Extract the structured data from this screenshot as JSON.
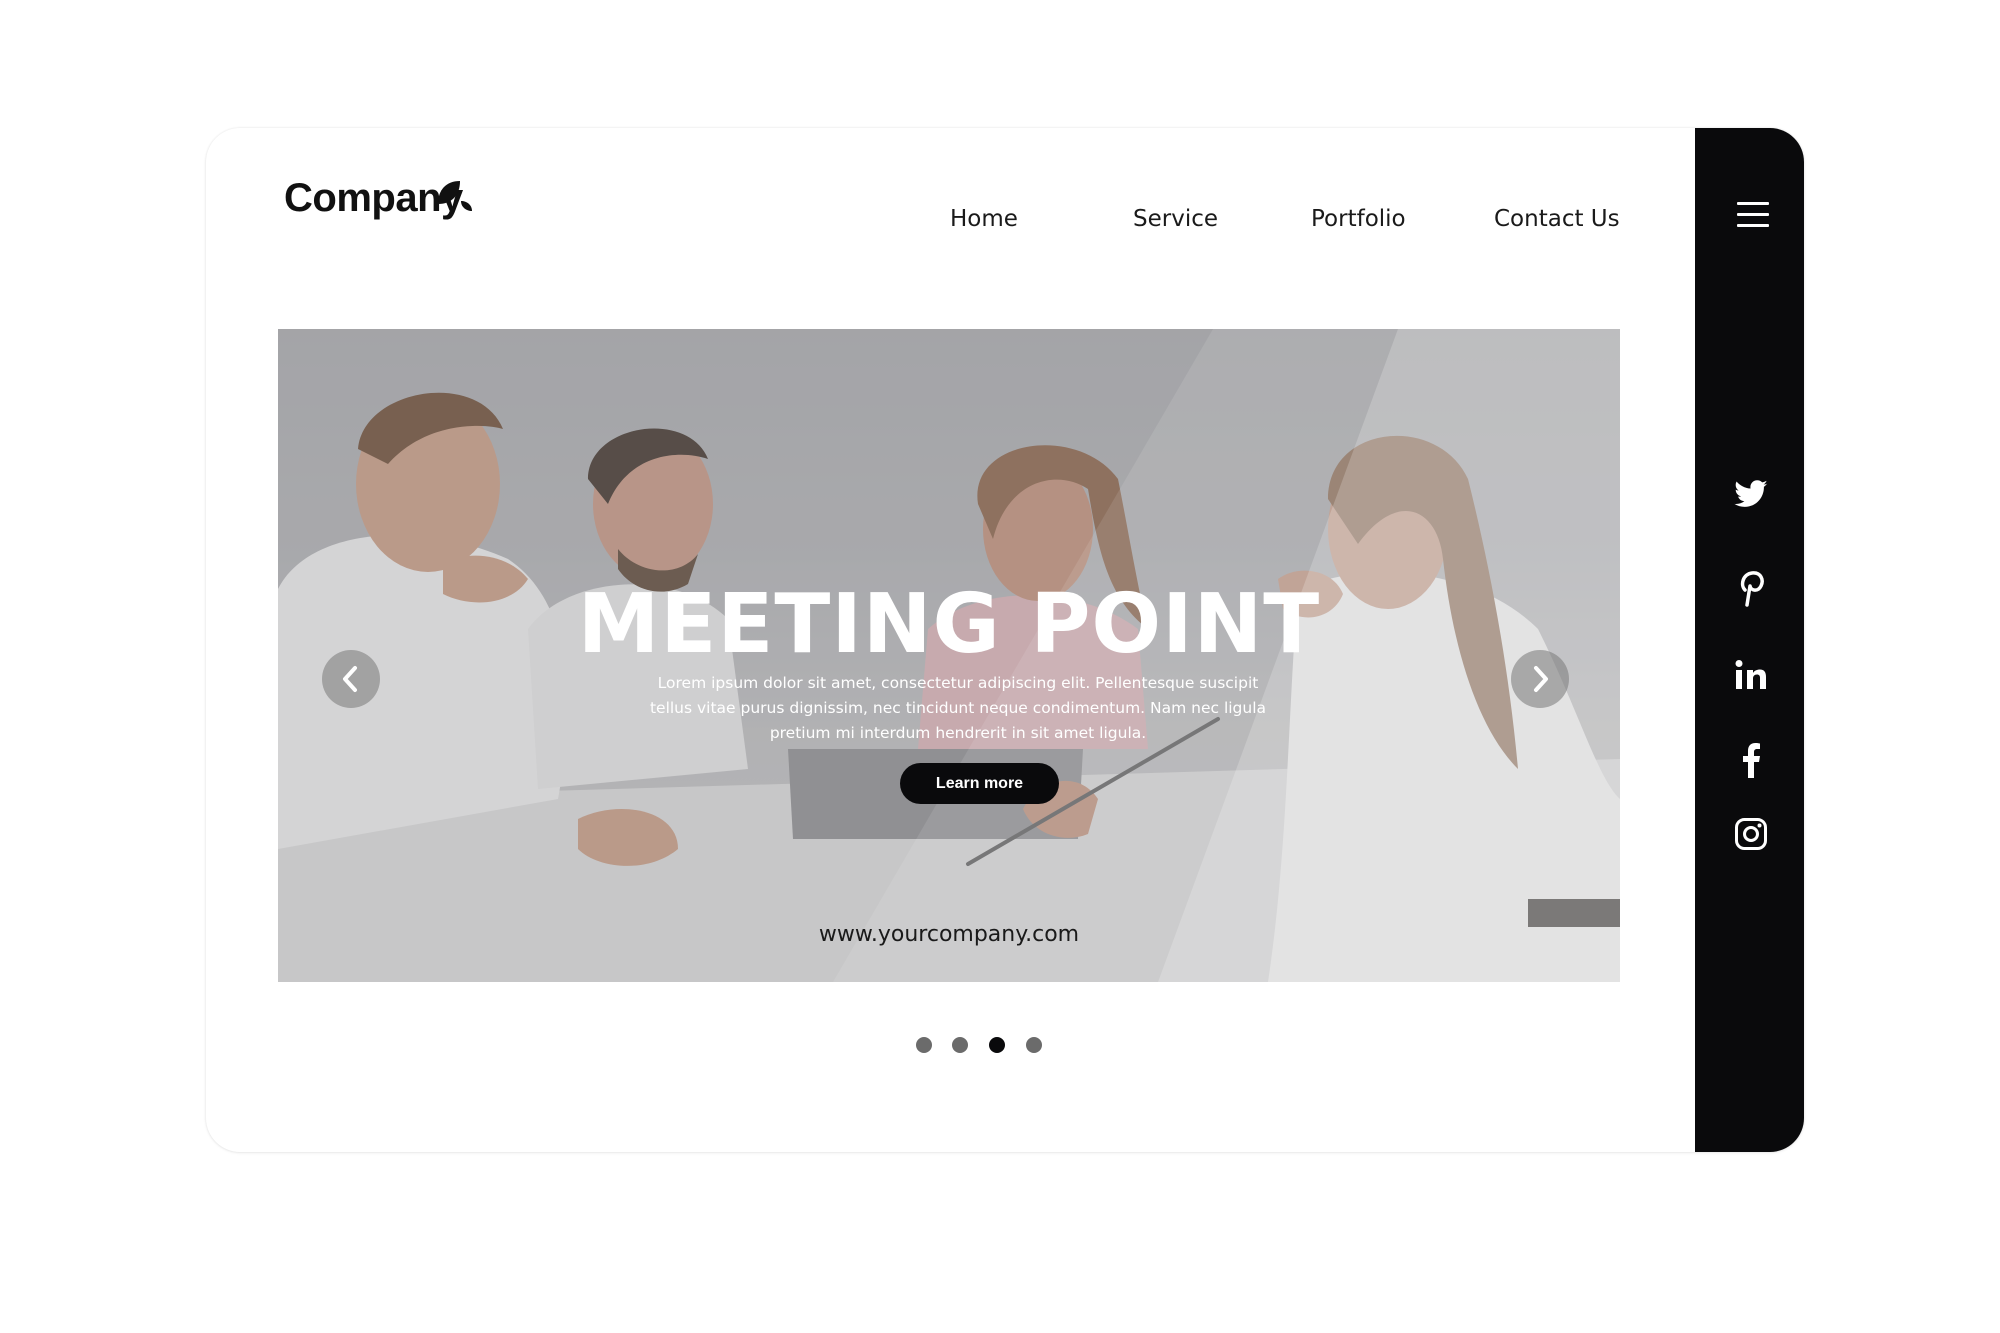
{
  "brand": {
    "name": "Company"
  },
  "nav": {
    "items": [
      {
        "label": "Home"
      },
      {
        "label": "Service"
      },
      {
        "label": "Portfolio"
      },
      {
        "label": "Contact Us"
      }
    ]
  },
  "hero": {
    "title": "MEETING POINT",
    "description": "Lorem ipsum dolor sit amet, consectetur adipiscing elit. Pellentesque suscipit tellus vitae purus dignissim, nec tincidunt neque condimentum. Nam nec ligula pretium mi interdum hendrerit in sit amet ligula.",
    "button_label": "Learn more",
    "website": "www.yourcompany.com",
    "prev_icon": "chevron-left-icon",
    "next_icon": "chevron-right-icon"
  },
  "carousel": {
    "slide_count": 4,
    "active_slide": 3
  },
  "sidebar": {
    "menu_icon": "hamburger-menu-icon",
    "social": [
      "twitter-icon",
      "pinterest-icon",
      "linkedin-icon",
      "facebook-icon",
      "instagram-icon"
    ]
  },
  "colors": {
    "accent": "#0a0a0c",
    "background": "#ffffff",
    "text": "#1a1a1a",
    "dot_inactive": "#6b6b6b"
  }
}
